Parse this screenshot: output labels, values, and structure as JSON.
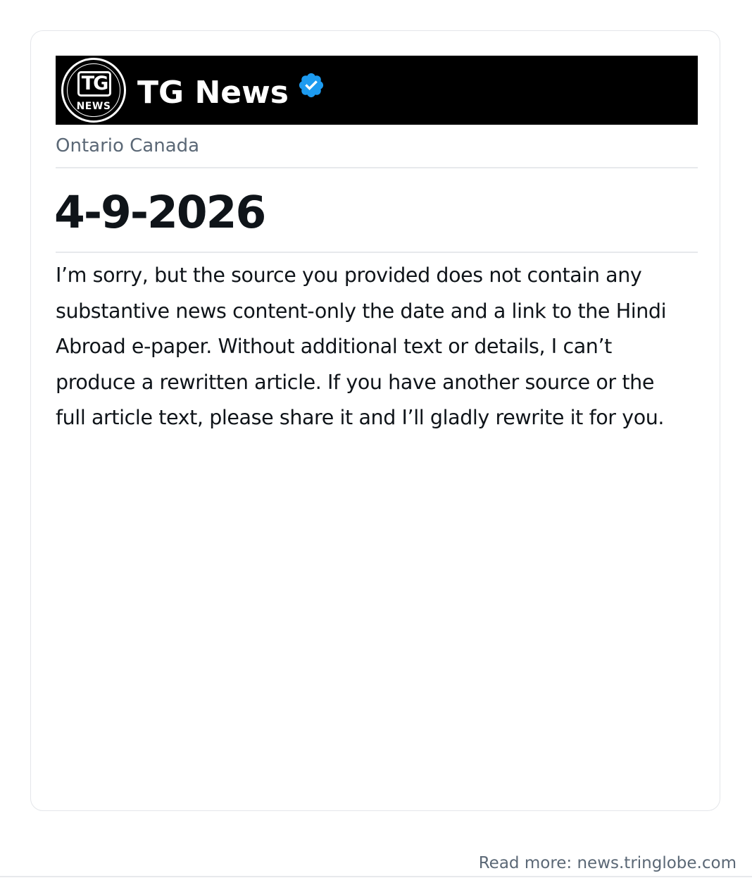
{
  "header": {
    "logo": {
      "top_text": "TG",
      "bottom_text": "NEWS"
    },
    "brand_name": "TG News",
    "verified_icon": "verified-badge-icon",
    "verified_color": "#1d9bf0",
    "bar_color": "#000000"
  },
  "post": {
    "location": "Ontario Canada",
    "date": "4-9-2026",
    "body": "I’m sorry, but the source you provided does not contain any substantive news content-only the date and a link to the Hindi Abroad e-paper. Without additional text or details, I can’t produce a rewritten article. If you have another source or the full article text, please share it and I’ll gladly rewrite it for you."
  },
  "footer": {
    "read_more": "Read more: news.tringlobe.com"
  }
}
